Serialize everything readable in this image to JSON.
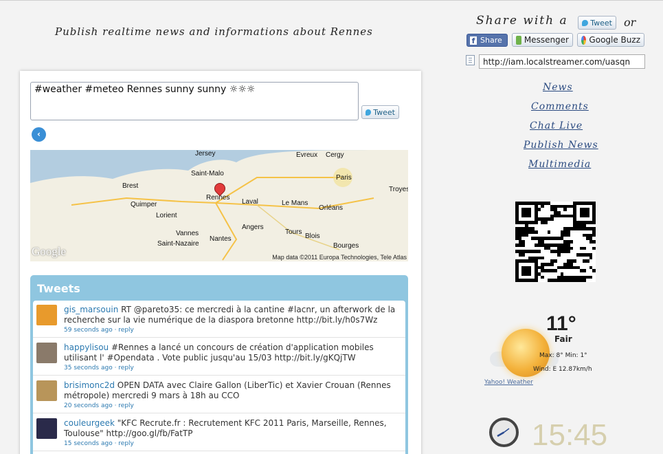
{
  "header": {
    "tagline": "Publish realtime news and informations about Rennes",
    "share_label": "Share with a",
    "share_or": "or",
    "tweet_label": "Tweet",
    "facebook_label": "Share",
    "messenger_label": "Messenger",
    "buzz_label": "Google Buzz",
    "short_url": "http://iam.localstreamer.com/uasqn"
  },
  "nav": {
    "items": [
      {
        "label": "News"
      },
      {
        "label": "Comments"
      },
      {
        "label": "Chat Live"
      },
      {
        "label": "Publish News"
      },
      {
        "label": "Multimedia"
      }
    ]
  },
  "composer": {
    "status_text": "#weather #meteo Rennes sunny sunny ☼☼☼",
    "tweet_label": "Tweet"
  },
  "map": {
    "labels": [
      "Jersey",
      "Evreux",
      "Cergy",
      "Saint-Malo",
      "Paris",
      "Brest",
      "Troyes",
      "Rennes",
      "Laval",
      "Le Mans",
      "Quimper",
      "Orléans",
      "Lorient",
      "Angers",
      "Vannes",
      "Tours",
      "Blois",
      "Saint-Nazaire",
      "Nantes",
      "Bourges"
    ],
    "logo": "Google",
    "attribution": "Map data ©2011 Europa Technologies, Tele Atlas"
  },
  "tweets": {
    "title": "Tweets",
    "items": [
      {
        "user": "gis_marsouin",
        "text": "RT @pareto35: ce mercredi à la cantine #lacnr, un afterwork de la recherche sur la vie numérique de la diaspora bretonne http://bit.ly/h0s7Wz",
        "time": "59 seconds ago",
        "reply": "reply",
        "avatar_color": "#e89a2c"
      },
      {
        "user": "happylisou",
        "text": "#Rennes a lancé un concours de création d'application mobiles utilisant l' #Opendata . Vote public jusqu'au 15/03 http://bit.ly/gKQjTW",
        "time": "35 seconds ago",
        "reply": "reply",
        "avatar_color": "#8a7a6a"
      },
      {
        "user": "brisimonc2d",
        "text": "OPEN DATA avec Claire Gallon (LiberTic) et Xavier Crouan (Rennes métropole) mercredi 9 mars à 18h au CCO",
        "time": "20 seconds ago",
        "reply": "reply",
        "avatar_color": "#b8955a"
      },
      {
        "user": "couleurgeek",
        "text": "\"KFC Recrute.fr : Recrutement KFC 2011 Paris, Marseille, Rennes, Toulouse\" http://goo.gl/fb/FatTP",
        "time": "15 seconds ago",
        "reply": "reply",
        "avatar_color": "#2a2a4a"
      }
    ]
  },
  "weather": {
    "temp": "11°",
    "condition": "Fair",
    "maxmin": "Max: 8° Min: 1°",
    "wind": "Wind: E 12.87km/h",
    "credit": "Yahoo! Weather"
  },
  "clock": {
    "time": "15:45"
  }
}
